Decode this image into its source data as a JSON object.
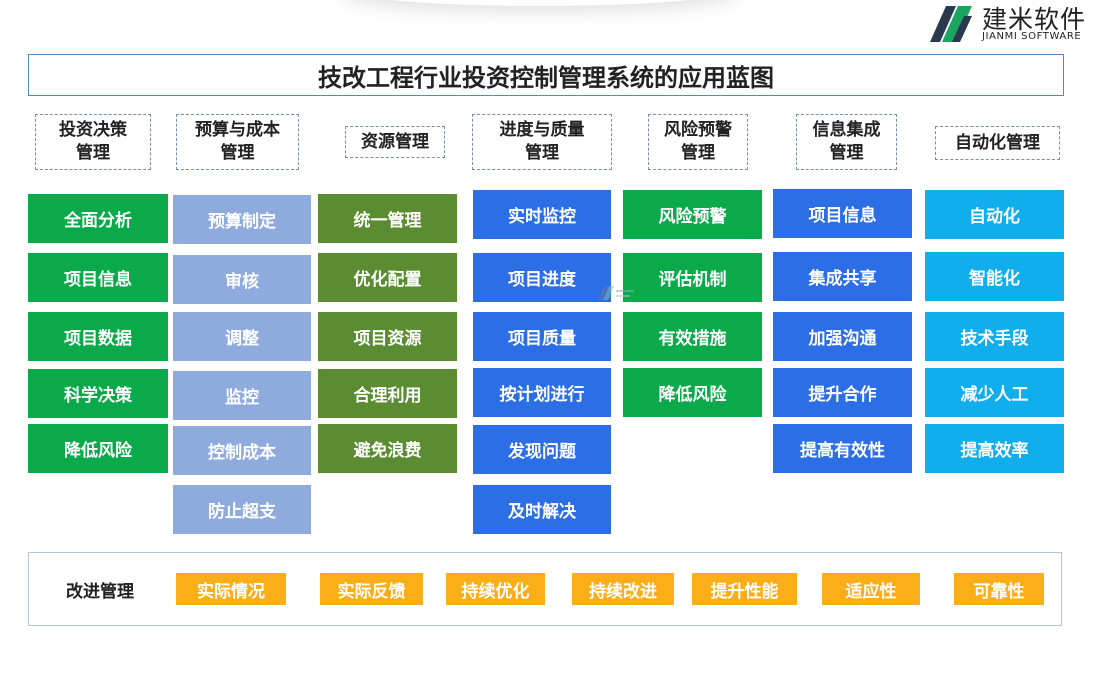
{
  "logo": {
    "name_cn": "建米软件",
    "name_en": "JIANMI SOFTWARE"
  },
  "title": "技改工程行业投资控制管理系统的应用蓝图",
  "colors": {
    "green": "#0aaa4b",
    "lavender": "#8faadc",
    "olive": "#5b8c32",
    "blue": "#2b6ee6",
    "cyan": "#11aeee",
    "orange": "#fbae17"
  },
  "columns": [
    {
      "header": "投资决策\n管理",
      "color": "#0aaa4b",
      "items": [
        "全面分析",
        "项目信息",
        "项目数据",
        "科学决策",
        "降低风险"
      ]
    },
    {
      "header": "预算与成本\n管理",
      "color": "#8faadc",
      "items": [
        "预算制定",
        "审核",
        "调整",
        "监控",
        "控制成本",
        "防止超支"
      ]
    },
    {
      "header": "资源管理",
      "color": "#5b8c32",
      "items": [
        "统一管理",
        "优化配置",
        "项目资源",
        "合理利用",
        "避免浪费"
      ]
    },
    {
      "header": "进度与质量\n管理",
      "color": "#2b6ee6",
      "items": [
        "实时监控",
        "项目进度",
        "项目质量",
        "按计划进行",
        "发现问题",
        "及时解决"
      ]
    },
    {
      "header": "风险预警\n管理",
      "color": "#0aaa4b",
      "items": [
        "风险预警",
        "评估机制",
        "有效措施",
        "降低风险"
      ]
    },
    {
      "header": "信息集成\n管理",
      "color": "#2b6ee6",
      "items": [
        "项目信息",
        "集成共享",
        "加强沟通",
        "提升合作",
        "提高有效性"
      ]
    },
    {
      "header": "自动化管理",
      "color": "#11aeee",
      "items": [
        "自动化",
        "智能化",
        "技术手段",
        "减少人工",
        "提高效率"
      ]
    }
  ],
  "improvement": {
    "label": "改进管理",
    "tags": [
      "实际情况",
      "实际反馈",
      "持续优化",
      "持续改进",
      "提升性能",
      "适应性",
      "可靠性"
    ]
  }
}
